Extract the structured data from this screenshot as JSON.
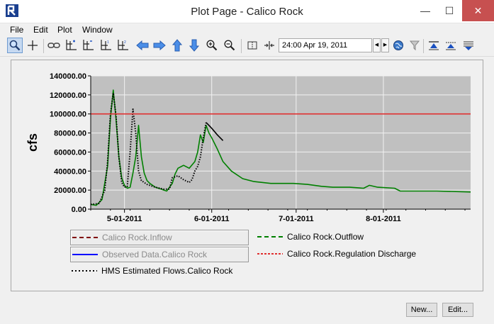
{
  "window": {
    "title": "Plot Page - Calico Rock",
    "minimize": "—",
    "maximize": "☐",
    "close": "✕"
  },
  "menu": [
    "File",
    "Edit",
    "Plot",
    "Window"
  ],
  "toolbar": {
    "time_value": "24:00 Apr 19, 2011"
  },
  "chart_data": {
    "type": "line",
    "ylabel": "cfs",
    "ylim": [
      0,
      140000
    ],
    "yticks": [
      "140000.00",
      "120000.00",
      "100000.00",
      "80000.00",
      "60000.00",
      "40000.00",
      "20000.00",
      "0.00"
    ],
    "xticks": [
      "5-01-2011",
      "6-01-2011",
      "7-01-2011",
      "8-01-2011"
    ],
    "x_range": [
      "2011-04-19",
      "2011-09-01"
    ],
    "grid": true,
    "series": [
      {
        "name": "Calico Rock.Outflow",
        "color": "#008000",
        "style": "solid",
        "points": [
          [
            "2011-04-19",
            5000
          ],
          [
            "2011-04-21",
            4000
          ],
          [
            "2011-04-23",
            10000
          ],
          [
            "2011-04-25",
            45000
          ],
          [
            "2011-04-26",
            95000
          ],
          [
            "2011-04-27",
            125000
          ],
          [
            "2011-04-28",
            95000
          ],
          [
            "2011-04-29",
            55000
          ],
          [
            "2011-04-30",
            33000
          ],
          [
            "2011-05-01",
            25000
          ],
          [
            "2011-05-02",
            22000
          ],
          [
            "2011-05-03",
            23000
          ],
          [
            "2011-05-04",
            38000
          ],
          [
            "2011-05-05",
            55000
          ],
          [
            "2011-05-06",
            88000
          ],
          [
            "2011-05-07",
            55000
          ],
          [
            "2011-05-08",
            38000
          ],
          [
            "2011-05-09",
            30000
          ],
          [
            "2011-05-10",
            27000
          ],
          [
            "2011-05-12",
            23000
          ],
          [
            "2011-05-14",
            21000
          ],
          [
            "2011-05-16",
            19000
          ],
          [
            "2011-05-18",
            27000
          ],
          [
            "2011-05-19",
            37000
          ],
          [
            "2011-05-20",
            43000
          ],
          [
            "2011-05-22",
            46000
          ],
          [
            "2011-05-24",
            43000
          ],
          [
            "2011-05-26",
            50000
          ],
          [
            "2011-05-27",
            60000
          ],
          [
            "2011-05-28",
            78000
          ],
          [
            "2011-05-29",
            70000
          ],
          [
            "2011-05-30",
            88000
          ],
          [
            "2011-05-31",
            80000
          ],
          [
            "2011-06-01",
            75000
          ],
          [
            "2011-06-03",
            63000
          ],
          [
            "2011-06-05",
            50000
          ],
          [
            "2011-06-08",
            40000
          ],
          [
            "2011-06-12",
            32000
          ],
          [
            "2011-06-16",
            29000
          ],
          [
            "2011-06-22",
            27000
          ],
          [
            "2011-06-30",
            27000
          ],
          [
            "2011-07-05",
            26000
          ],
          [
            "2011-07-10",
            24000
          ],
          [
            "2011-07-14",
            23000
          ],
          [
            "2011-07-20",
            23000
          ],
          [
            "2011-07-25",
            22000
          ],
          [
            "2011-07-27",
            25000
          ],
          [
            "2011-07-30",
            23000
          ],
          [
            "2011-08-05",
            22000
          ],
          [
            "2011-08-07",
            19000
          ],
          [
            "2011-08-20",
            19000
          ],
          [
            "2011-09-01",
            18000
          ]
        ]
      },
      {
        "name": "HMS Estimated Flows.Calico Rock",
        "color": "#000000",
        "style": "dotted",
        "points": [
          [
            "2011-04-19",
            5000
          ],
          [
            "2011-04-22",
            6000
          ],
          [
            "2011-04-24",
            20000
          ],
          [
            "2011-04-25",
            50000
          ],
          [
            "2011-04-26",
            100000
          ],
          [
            "2011-04-27",
            122000
          ],
          [
            "2011-04-28",
            98000
          ],
          [
            "2011-04-29",
            55000
          ],
          [
            "2011-04-30",
            28000
          ],
          [
            "2011-05-01",
            23000
          ],
          [
            "2011-05-02",
            24000
          ],
          [
            "2011-05-03",
            60000
          ],
          [
            "2011-05-04",
            105000
          ],
          [
            "2011-05-05",
            80000
          ],
          [
            "2011-05-06",
            40000
          ],
          [
            "2011-05-07",
            30000
          ],
          [
            "2011-05-09",
            26000
          ],
          [
            "2011-05-12",
            23000
          ],
          [
            "2011-05-15",
            21000
          ],
          [
            "2011-05-17",
            21000
          ],
          [
            "2011-05-18",
            33000
          ],
          [
            "2011-05-20",
            35000
          ],
          [
            "2011-05-22",
            31000
          ],
          [
            "2011-05-24",
            28000
          ],
          [
            "2011-05-25",
            31000
          ],
          [
            "2011-05-26",
            40000
          ],
          [
            "2011-05-27",
            45000
          ],
          [
            "2011-05-28",
            55000
          ],
          [
            "2011-05-29",
            75000
          ],
          [
            "2011-05-30",
            91000
          ]
        ]
      },
      {
        "name": "HMS Estimated Flows.Calico Rock",
        "color": "#000000",
        "style": "solid",
        "points": [
          [
            "2011-05-30",
            91000
          ],
          [
            "2011-05-31",
            88000
          ],
          [
            "2011-06-01",
            85000
          ],
          [
            "2011-06-03",
            78000
          ],
          [
            "2011-06-05",
            72000
          ]
        ]
      },
      {
        "name": "Calico Rock.Regulation Discharge",
        "color": "#e03030",
        "style": "solid",
        "points": [
          [
            "2011-04-19",
            100000
          ],
          [
            "2011-09-01",
            100000
          ]
        ]
      }
    ]
  },
  "legend": [
    {
      "label": "Calico Rock.Inflow",
      "color": "#800000",
      "dash": "6,4",
      "disabled": true
    },
    {
      "label": "Calico Rock.Outflow",
      "color": "#008000",
      "dash": "6,4",
      "disabled": false
    },
    {
      "label": "Observed Data.Calico Rock",
      "color": "#0000ff",
      "dash": "",
      "disabled": true
    },
    {
      "label": "Calico Rock.Regulation Discharge",
      "color": "#e03030",
      "dash": "3,2",
      "disabled": false
    },
    {
      "label": "HMS Estimated Flows.Calico Rock",
      "color": "#000000",
      "dash": "2,3",
      "disabled": false
    }
  ],
  "buttons": {
    "new": "New...",
    "edit": "Edit..."
  }
}
